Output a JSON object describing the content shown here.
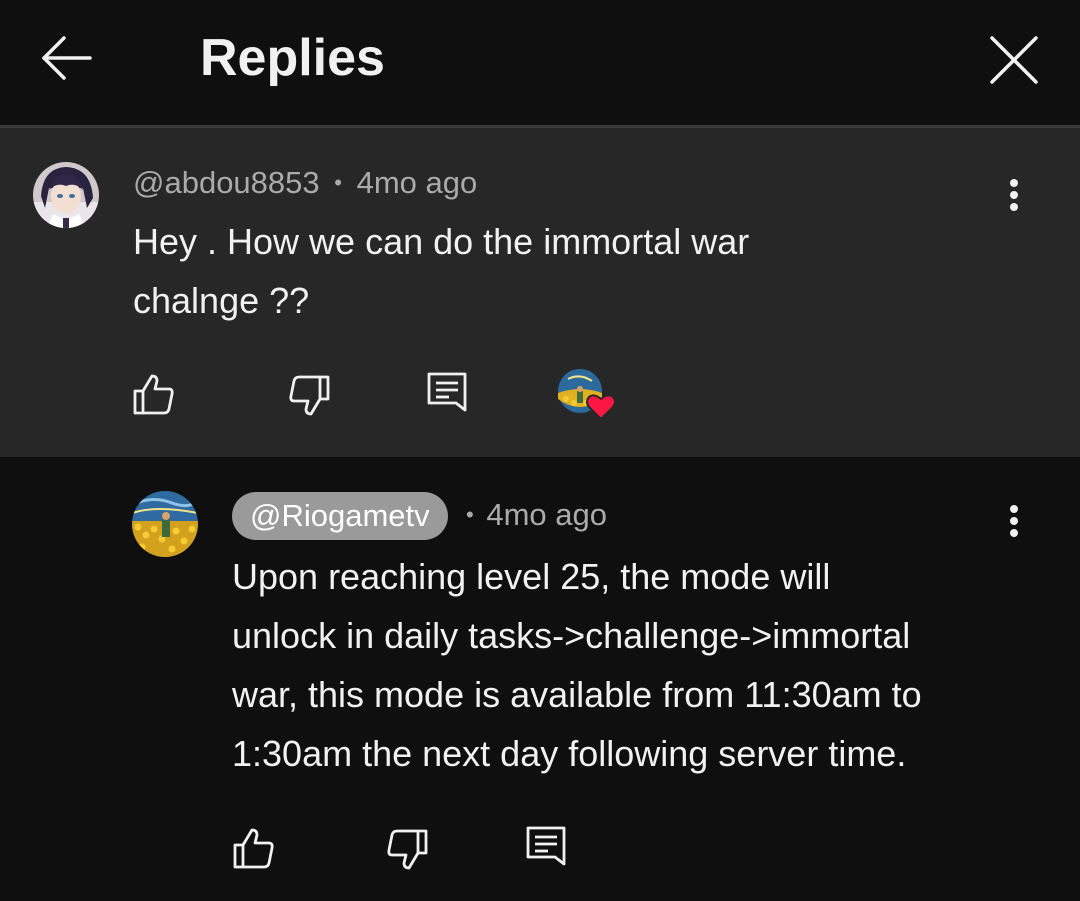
{
  "header": {
    "title": "Replies"
  },
  "parent": {
    "author": "@abdou8853",
    "separator": "•",
    "time": "4mo ago",
    "lines": [
      "Hey . How we can do the immortal war",
      "chalnge ??"
    ]
  },
  "reply": {
    "author": "@Riogametv",
    "separator": "•",
    "time": "4mo ago",
    "lines": [
      "Upon reaching level 25, the mode will",
      "unlock in daily tasks->challenge->immortal",
      "war, this mode is available from 11:30am to",
      "1:30am the next day following server time."
    ]
  },
  "colors": {
    "background": "#0f0f0f",
    "parent_background": "#272727",
    "text_primary": "#f1f1f1",
    "text_secondary": "#aaaaaa",
    "heart": "#ff1744",
    "author_chip": "#9a9a9a"
  },
  "icons": {
    "back": "arrow-left-icon",
    "close": "close-icon",
    "like": "thumb-up-icon",
    "dislike": "thumb-down-icon",
    "reply": "comment-icon",
    "more": "more-vertical-icon",
    "creator_heart": "heart-icon"
  }
}
